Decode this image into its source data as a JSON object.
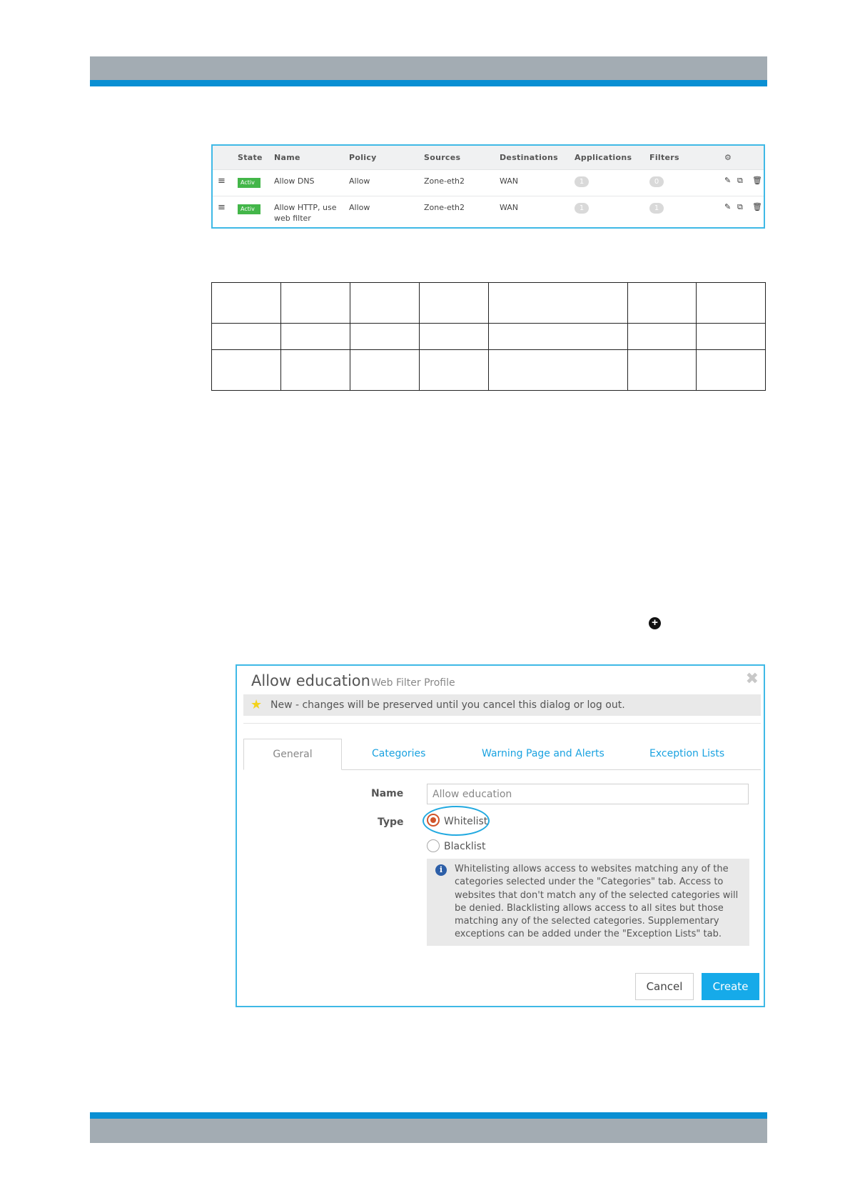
{
  "rules_table": {
    "columns": [
      "State",
      "Name",
      "Policy",
      "Sources",
      "Destinations",
      "Applications",
      "Filters"
    ],
    "settings_icon": "gear-icon",
    "rows": [
      {
        "state": "Activ",
        "name": "Allow DNS",
        "name_line2": "",
        "policy": "Allow",
        "sources": "Zone-eth2",
        "destinations": "WAN",
        "applications": "1",
        "filters": "0"
      },
      {
        "state": "Activ",
        "name": "Allow HTTP, use",
        "name_line2": "web filter",
        "policy": "Allow",
        "sources": "Zone-eth2",
        "destinations": "WAN",
        "applications": "1",
        "filters": "1"
      }
    ],
    "row_icons": [
      "menu-icon",
      "edit-icon",
      "copy-icon",
      "delete-icon"
    ]
  },
  "dialog": {
    "title": "Allow education",
    "subtitle": "Web Filter Profile",
    "notice": "New - changes will be preserved until you cancel this dialog or log out.",
    "tabs": [
      "General",
      "Categories",
      "Warning Page and Alerts",
      "Exception Lists"
    ],
    "active_tab": "General",
    "name_label": "Name",
    "name_value": "Allow education",
    "type_label": "Type",
    "type_options": [
      "Whitelist",
      "Blacklist"
    ],
    "type_selected": "Whitelist",
    "info_text": "Whitelisting allows access to websites matching any of the categories selected under the \"Categories\" tab. Access to websites that don't match any of the selected categories will be denied. Blacklisting allows access to all sites but those matching any of the selected categories. Supplementary exceptions can be added under the \"Exception Lists\" tab.",
    "cancel_label": "Cancel",
    "create_label": "Create"
  },
  "colors": {
    "accent": "#16aae9",
    "active_badge": "#43b649",
    "header_bar": "#a3acb3",
    "header_stripe": "#0a8fd3"
  }
}
